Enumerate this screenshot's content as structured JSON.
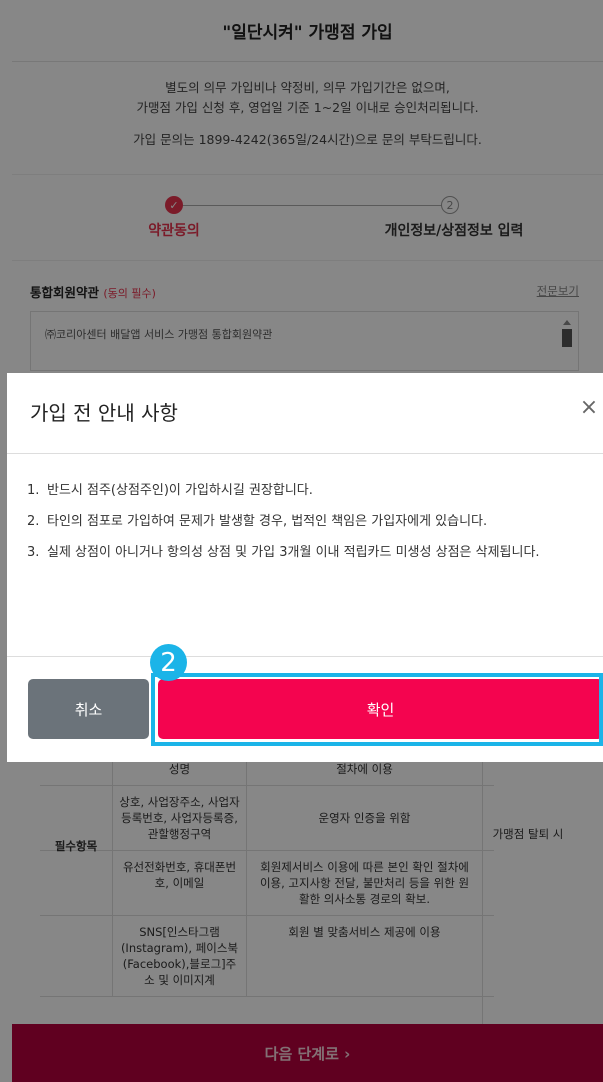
{
  "header": {
    "title": "\"일단시켜\" 가맹점 가입"
  },
  "intro": {
    "line1": "별도의 의무 가입비나 약정비, 의무 가입기간은 없으며,",
    "line2": "가맹점 가입 신청 후, 영업일 기준 1~2일 이내로 승인처리됩니다.",
    "line3": "가입 문의는 1899-4242(365일/24시간)으로 문의 부탁드립니다."
  },
  "steps": {
    "step1_label": "약관동의",
    "step1_mark": "✓",
    "step2_number": "2",
    "step2_label": "개인정보/상점정보 입력"
  },
  "terms": {
    "title": "통합회원약관",
    "required": "(동의 필수)",
    "view_full": "전문보기",
    "content": "㈜코리아센터 배달앱 서비스 가맹점 통합회원약관"
  },
  "table": {
    "row_header": "필수항목",
    "retention": "가맹점 탈퇴 시",
    "rows": [
      {
        "item": "성명",
        "purpose": "절차에 이용"
      },
      {
        "item": "상호, 사업장주소, 사업자등록번호, 사업자등록증, 관할행정구역",
        "purpose": "운영자 인증을 위함"
      },
      {
        "item": "유선전화번호, 휴대폰번호, 이메일",
        "purpose": "회원제서비스 이용에 따른 본인 확인 절차에 이용, 고지사항 전달, 불만처리 등을 위한 원활한 의사소통 경로의 확보."
      },
      {
        "item": "SNS[인스타그램(Instagram), 페이스북(Facebook),블로그]주소 및 이미지계",
        "purpose": "회원 별 맞춤서비스 제공에 이용"
      }
    ]
  },
  "next_button": {
    "label": "다음 단계로 ›"
  },
  "modal": {
    "title": "가입 전 안내 사항",
    "close": "×",
    "notices": [
      {
        "num": "1.",
        "text": "반드시 점주(상점주인)이 가입하시길 권장합니다."
      },
      {
        "num": "2.",
        "text": "타인의 점포로 가입하여 문제가 발생할 경우, 법적인 책임은 가입자에게 있습니다."
      },
      {
        "num": "3.",
        "text": "실제 상점이 아니거나 항의성 상점 및 가입 3개월 이내 적립카드 미생성 상점은 삭제됩니다."
      }
    ],
    "cancel_label": "취소",
    "confirm_label": "확인",
    "annotation_number": "2"
  },
  "colors": {
    "accent": "#e8344e",
    "confirm": "#f4044f",
    "cancel": "#6b737a",
    "next_bg": "#b6003d",
    "highlight": "#1bb4e8"
  }
}
